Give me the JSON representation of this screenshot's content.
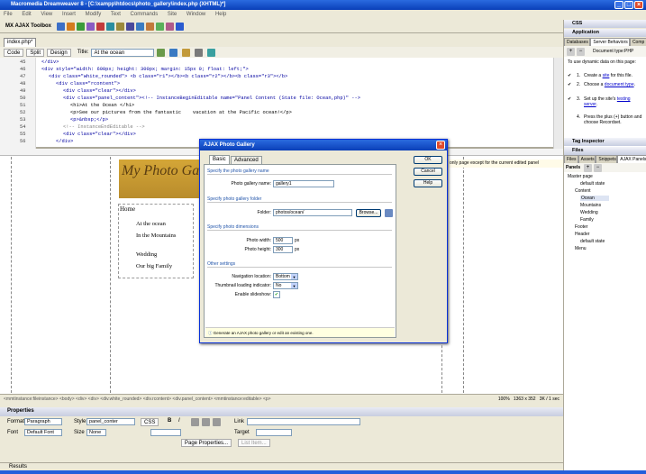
{
  "window": {
    "title": "Macromedia Dreamweaver 8 - [C:\\xampp\\htdocs\\photo_gallery\\index.php (XHTML)*]"
  },
  "menu": [
    "File",
    "Edit",
    "View",
    "Insert",
    "Modify",
    "Text",
    "Commands",
    "Site",
    "Window",
    "Help"
  ],
  "insert_bar": {
    "category": "MX AJAX Toolbox"
  },
  "document": {
    "tab": "index.php*",
    "views": [
      "Code",
      "Split",
      "Design"
    ],
    "title_label": "Title:",
    "title_value": "At the ocean"
  },
  "code": {
    "line_numbers": [
      "45",
      "46",
      "47",
      "48",
      "49",
      "50",
      "51",
      "52",
      "53",
      "54",
      "55",
      "56"
    ],
    "lines": [
      "</div>",
      "<div style=\"width: 600px; height: 300px; margin: 15px 0; float: left;\">",
      "<div class=\"white_rounded\"> <b class=\"r1\"></b><b class=\"r2\"></b><b class=\"r3\"></b>",
      "<div class=\"rcontent\">",
      "<div class=\"clear\"></div>",
      "<div class=\"panel_content\"><!-- InstanceBeginEditable name=\"Panel Content (State file: Ocean,php)\" -->",
      "<h1>At the Ocean </h1>",
      "<p>See our pictures from the fantastic    vacation at the Pacific ocean!</p>",
      "<p>&nbsp;</p>",
      "<!-- InstanceEndEditable -->",
      "<div class=\"clear\"></div>",
      "</div>"
    ]
  },
  "design": {
    "banner_title": "My Photo Gallery",
    "home": "Home",
    "nav": [
      "At the ocean",
      "In the Mountains",
      "Wedding",
      "Our big Family"
    ],
    "right_note": "only page except for the current edited panel"
  },
  "status": {
    "tags": "<mmtinstance:fileinstance> <body> <div> <div> <div.white_rounded> <div.rcontent> <div.panel_content> <mmtinstance:editable> <p>",
    "zoom": "100%",
    "size": "1363 x 352",
    "weight": "3K / 1 sec"
  },
  "properties": {
    "header": "Properties",
    "format_label": "Format",
    "format_value": "Paragraph",
    "style_label": "Style",
    "style_value": "panel_conter",
    "css_button": "CSS",
    "link_label": "Link",
    "font_label": "Font",
    "font_value": "Default Font",
    "size_label": "Size",
    "size_value": "None",
    "target_label": "Target",
    "page_properties": "Page Properties...",
    "list_item": "List Item..."
  },
  "results_label": "Results",
  "right_panels": {
    "css": "CSS",
    "application": "Application",
    "app_tabs": [
      "Databases",
      "Server Behaviors",
      "Comp"
    ],
    "doc_type": "Document type:PHP",
    "intro": "To use dynamic data on this page:",
    "steps": [
      {
        "num": "1.",
        "pre": "Create a ",
        "link": "site",
        "post": " for this file."
      },
      {
        "num": "2.",
        "pre": "Choose a ",
        "link": "document type",
        "post": "."
      },
      {
        "num": "3.",
        "pre": "Set up the site's ",
        "link": "testing server",
        "post": "."
      },
      {
        "num": "4.",
        "pre": "Press the plus (+) button and choose Recordset.",
        "link": "",
        "post": ""
      }
    ],
    "tag_inspector": "Tag Inspector",
    "files": "Files",
    "files_tabs": [
      "Files",
      "Assets",
      "Snippets",
      "AJAX Panels"
    ],
    "panels_label": "Panels",
    "tree": [
      {
        "label": "Master page",
        "depth": 0
      },
      {
        "label": "default state",
        "depth": 2
      },
      {
        "label": "Content",
        "depth": 1
      },
      {
        "label": "Ocean",
        "depth": 2
      },
      {
        "label": "Mountains",
        "depth": 2
      },
      {
        "label": "Wedding",
        "depth": 2
      },
      {
        "label": "Family",
        "depth": 2
      },
      {
        "label": "Footer",
        "depth": 1
      },
      {
        "label": "Header",
        "depth": 1
      },
      {
        "label": "default state",
        "depth": 2
      },
      {
        "label": "Menu",
        "depth": 1
      }
    ]
  },
  "dialog": {
    "title": "AJAX Photo Gallery",
    "tabs": [
      "Basic",
      "Advanced"
    ],
    "section_name": "Specify the photo gallery name",
    "name_label": "Photo gallery name:",
    "name_value": "gallery1",
    "section_folder": "Specify photo gallery folder",
    "folder_label": "Folder:",
    "folder_value": "photos/ocean/",
    "browse": "Browse...",
    "section_dims": "Specify photo dimensions",
    "width_label": "Photo width:",
    "width_value": "500",
    "height_label": "Photo height:",
    "height_value": "300",
    "unit": "px",
    "section_other": "Other settings",
    "nav_label": "Navigation location:",
    "nav_value": "Bottom",
    "thumb_label": "Thumbnail loading indicator:",
    "thumb_value": "No",
    "slideshow_label": "Enable slideshow:",
    "slideshow_checked": true,
    "hint": "Generate an AJAX photo gallery or edit an existing one.",
    "ok": "OK",
    "cancel": "Cancel",
    "help": "Help"
  }
}
